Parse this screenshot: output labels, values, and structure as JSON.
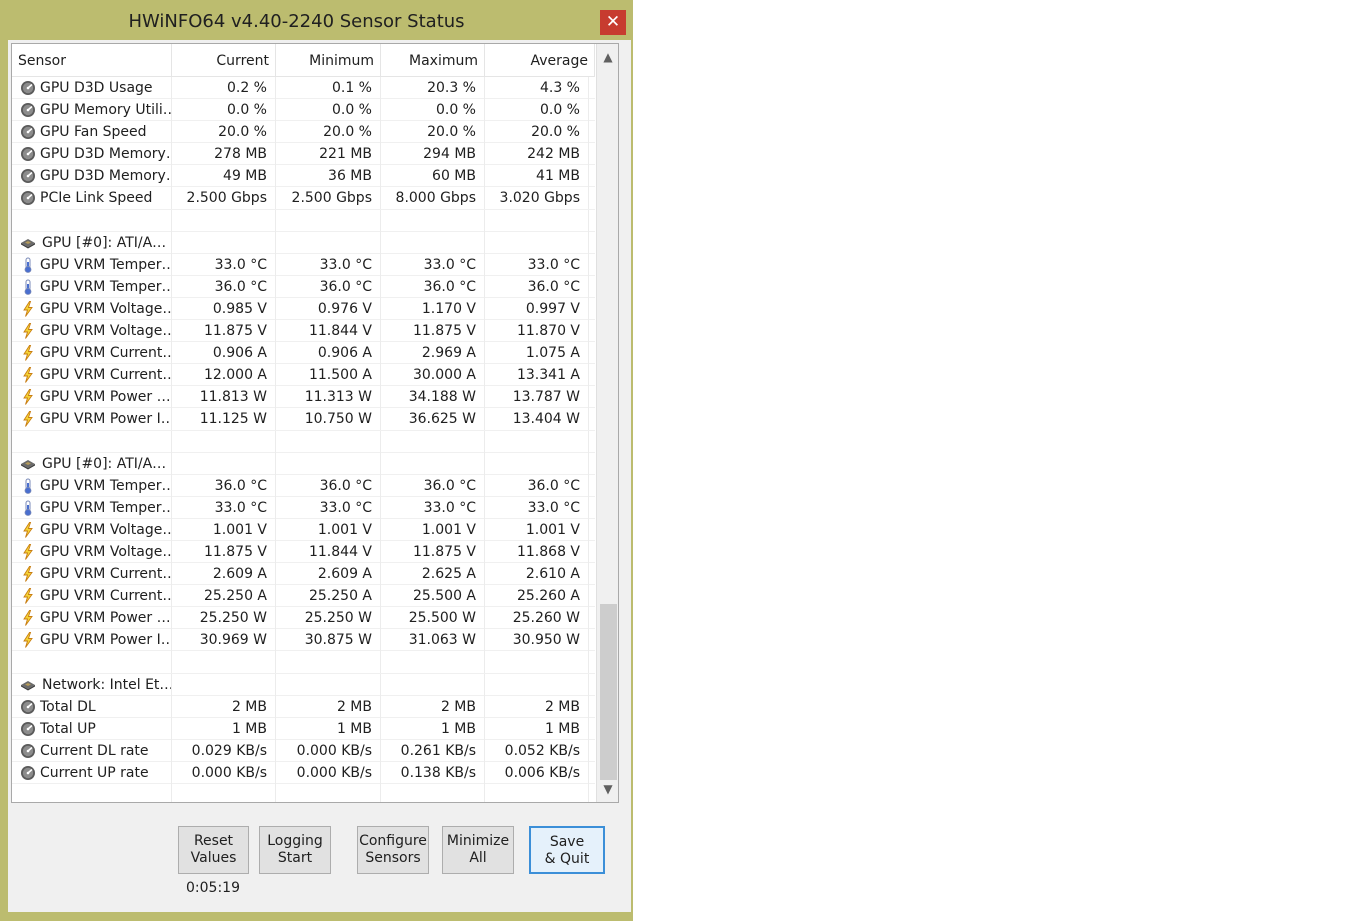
{
  "window": {
    "title": "HWiNFO64 v4.40-2240 Sensor Status",
    "close_glyph": "✕",
    "colors": {
      "frame": "#bcbc6f",
      "close": "#c73b2f",
      "accent": "#3c8fd8"
    }
  },
  "columns": [
    "Sensor",
    "Current",
    "Minimum",
    "Maximum",
    "Average"
  ],
  "rows": [
    {
      "icon": "gauge-icon",
      "name": "GPU D3D Usage",
      "values": [
        "0.2 %",
        "0.1 %",
        "20.3 %",
        "4.3 %"
      ]
    },
    {
      "icon": "gauge-icon",
      "name": "GPU Memory Utili…",
      "values": [
        "0.0 %",
        "0.0 %",
        "0.0 %",
        "0.0 %"
      ]
    },
    {
      "icon": "gauge-icon",
      "name": "GPU Fan Speed",
      "values": [
        "20.0 %",
        "20.0 %",
        "20.0 %",
        "20.0 %"
      ]
    },
    {
      "icon": "gauge-icon",
      "name": "GPU D3D Memory…",
      "values": [
        "278 MB",
        "221 MB",
        "294 MB",
        "242 MB"
      ]
    },
    {
      "icon": "gauge-icon",
      "name": "GPU D3D Memory…",
      "values": [
        "49 MB",
        "36 MB",
        "60 MB",
        "41 MB"
      ]
    },
    {
      "icon": "gauge-icon",
      "name": "PCIe Link Speed",
      "values": [
        "2.500 Gbps",
        "2.500 Gbps",
        "8.000 Gbps",
        "3.020 Gbps"
      ]
    },
    {
      "icon": "",
      "name": "",
      "values": [
        "",
        "",
        "",
        ""
      ]
    },
    {
      "icon": "chip-icon",
      "name": "GPU [#0]: ATI/A…",
      "values": [
        "",
        "",
        "",
        ""
      ],
      "group": true
    },
    {
      "icon": "thermometer-icon",
      "name": "GPU VRM Temper…",
      "values": [
        "33.0 °C",
        "33.0 °C",
        "33.0 °C",
        "33.0 °C"
      ]
    },
    {
      "icon": "thermometer-icon",
      "name": "GPU VRM Temper…",
      "values": [
        "36.0 °C",
        "36.0 °C",
        "36.0 °C",
        "36.0 °C"
      ]
    },
    {
      "icon": "lightning-icon",
      "name": "GPU VRM Voltage…",
      "values": [
        "0.985 V",
        "0.976 V",
        "1.170 V",
        "0.997 V"
      ]
    },
    {
      "icon": "lightning-icon",
      "name": "GPU VRM Voltage…",
      "values": [
        "11.875 V",
        "11.844 V",
        "11.875 V",
        "11.870 V"
      ]
    },
    {
      "icon": "lightning-icon",
      "name": "GPU VRM Current…",
      "values": [
        "0.906 A",
        "0.906 A",
        "2.969 A",
        "1.075 A"
      ]
    },
    {
      "icon": "lightning-icon",
      "name": "GPU VRM Current…",
      "values": [
        "12.000 A",
        "11.500 A",
        "30.000 A",
        "13.341 A"
      ]
    },
    {
      "icon": "lightning-icon",
      "name": "GPU VRM Power …",
      "values": [
        "11.813 W",
        "11.313 W",
        "34.188 W",
        "13.787 W"
      ]
    },
    {
      "icon": "lightning-icon",
      "name": "GPU VRM Power I…",
      "values": [
        "11.125 W",
        "10.750 W",
        "36.625 W",
        "13.404 W"
      ]
    },
    {
      "icon": "",
      "name": "",
      "values": [
        "",
        "",
        "",
        ""
      ]
    },
    {
      "icon": "chip-icon",
      "name": "GPU [#0]: ATI/A…",
      "values": [
        "",
        "",
        "",
        ""
      ],
      "group": true
    },
    {
      "icon": "thermometer-icon",
      "name": "GPU VRM Temper…",
      "values": [
        "36.0 °C",
        "36.0 °C",
        "36.0 °C",
        "36.0 °C"
      ]
    },
    {
      "icon": "thermometer-icon",
      "name": "GPU VRM Temper…",
      "values": [
        "33.0 °C",
        "33.0 °C",
        "33.0 °C",
        "33.0 °C"
      ]
    },
    {
      "icon": "lightning-icon",
      "name": "GPU VRM Voltage…",
      "values": [
        "1.001 V",
        "1.001 V",
        "1.001 V",
        "1.001 V"
      ]
    },
    {
      "icon": "lightning-icon",
      "name": "GPU VRM Voltage…",
      "values": [
        "11.875 V",
        "11.844 V",
        "11.875 V",
        "11.868 V"
      ]
    },
    {
      "icon": "lightning-icon",
      "name": "GPU VRM Current…",
      "values": [
        "2.609 A",
        "2.609 A",
        "2.625 A",
        "2.610 A"
      ]
    },
    {
      "icon": "lightning-icon",
      "name": "GPU VRM Current…",
      "values": [
        "25.250 A",
        "25.250 A",
        "25.500 A",
        "25.260 A"
      ]
    },
    {
      "icon": "lightning-icon",
      "name": "GPU VRM Power …",
      "values": [
        "25.250 W",
        "25.250 W",
        "25.500 W",
        "25.260 W"
      ]
    },
    {
      "icon": "lightning-icon",
      "name": "GPU VRM Power I…",
      "values": [
        "30.969 W",
        "30.875 W",
        "31.063 W",
        "30.950 W"
      ]
    },
    {
      "icon": "",
      "name": "",
      "values": [
        "",
        "",
        "",
        ""
      ]
    },
    {
      "icon": "network-icon",
      "name": "Network: Intel Et…",
      "values": [
        "",
        "",
        "",
        ""
      ],
      "group": true
    },
    {
      "icon": "gauge-icon",
      "name": "Total DL",
      "values": [
        "2 MB",
        "2 MB",
        "2 MB",
        "2 MB"
      ]
    },
    {
      "icon": "gauge-icon",
      "name": "Total UP",
      "values": [
        "1 MB",
        "1 MB",
        "1 MB",
        "1 MB"
      ]
    },
    {
      "icon": "gauge-icon",
      "name": "Current DL rate",
      "values": [
        "0.029 KB/s",
        "0.000 KB/s",
        "0.261 KB/s",
        "0.052 KB/s"
      ]
    },
    {
      "icon": "gauge-icon",
      "name": "Current UP rate",
      "values": [
        "0.000 KB/s",
        "0.000 KB/s",
        "0.138 KB/s",
        "0.006 KB/s"
      ]
    },
    {
      "icon": "",
      "name": "",
      "values": [
        "",
        "",
        "",
        ""
      ]
    }
  ],
  "buttons": {
    "reset": {
      "line1": "Reset",
      "line2": "Values"
    },
    "logging": {
      "line1": "Logging",
      "line2": "Start"
    },
    "configure": {
      "line1": "Configure",
      "line2": "Sensors"
    },
    "minimize": {
      "line1": "Minimize",
      "line2": "All"
    },
    "save": {
      "line1": "Save",
      "line2": "& Quit"
    }
  },
  "timer": "0:05:19"
}
